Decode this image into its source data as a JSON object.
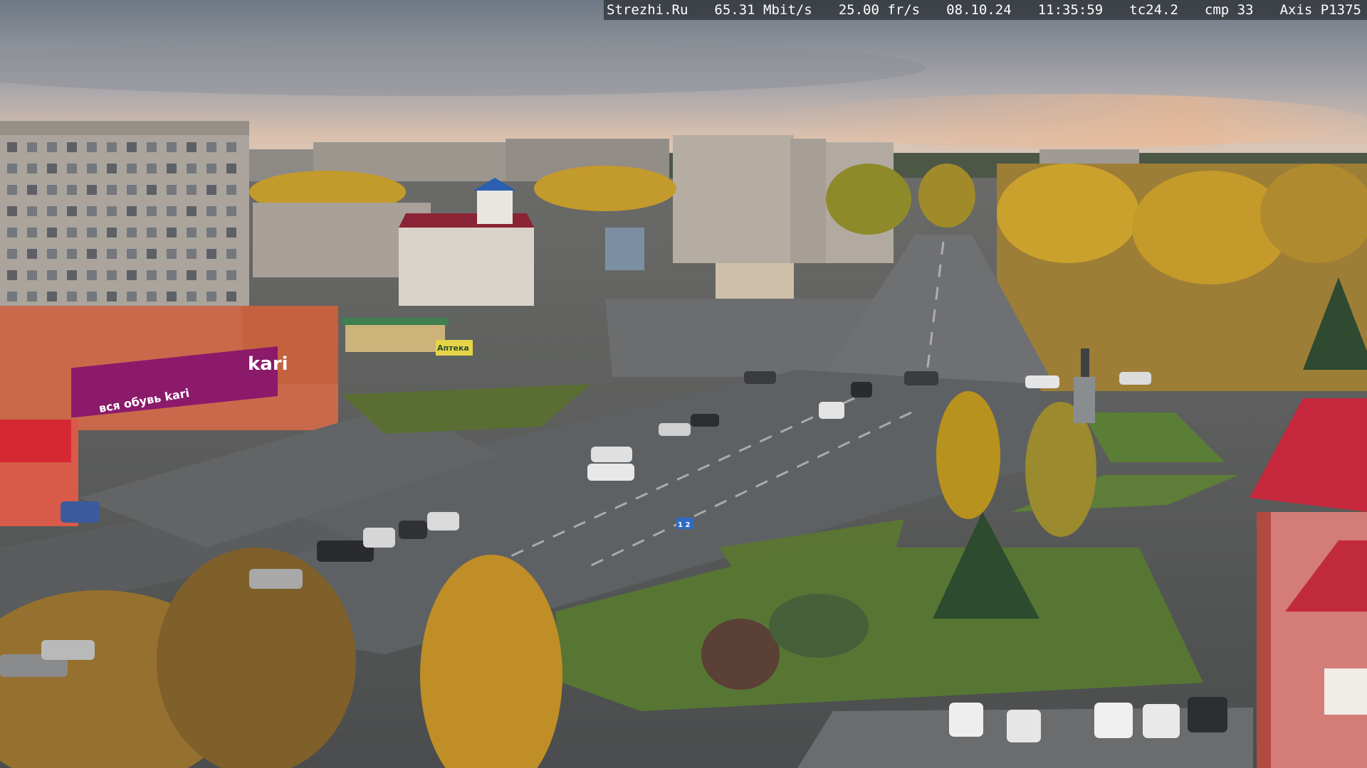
{
  "overlay": {
    "site": "Strezhi.Ru",
    "bitrate": "65.31 Mbit/s",
    "framerate": "25.00 fr/s",
    "date": "08.10.24",
    "time": "11:35:59",
    "tc": "tc24.2",
    "cmp": "cmp 33",
    "camera_model": "Axis P1375"
  },
  "signs": {
    "kari_logo": "kari",
    "kari_side": "вся обувь kari",
    "pharmacy": "Аптека",
    "road_sign": "1 2"
  },
  "colors": {
    "sky_top": "#6f7a86",
    "sky_horizon": "#e8c8b0",
    "foliage_gold": "#c8a030",
    "asphalt": "#5c5f62",
    "grass": "#5d7a34",
    "kari_magenta": "#8b1a6b",
    "roof_red": "#b0243a"
  }
}
